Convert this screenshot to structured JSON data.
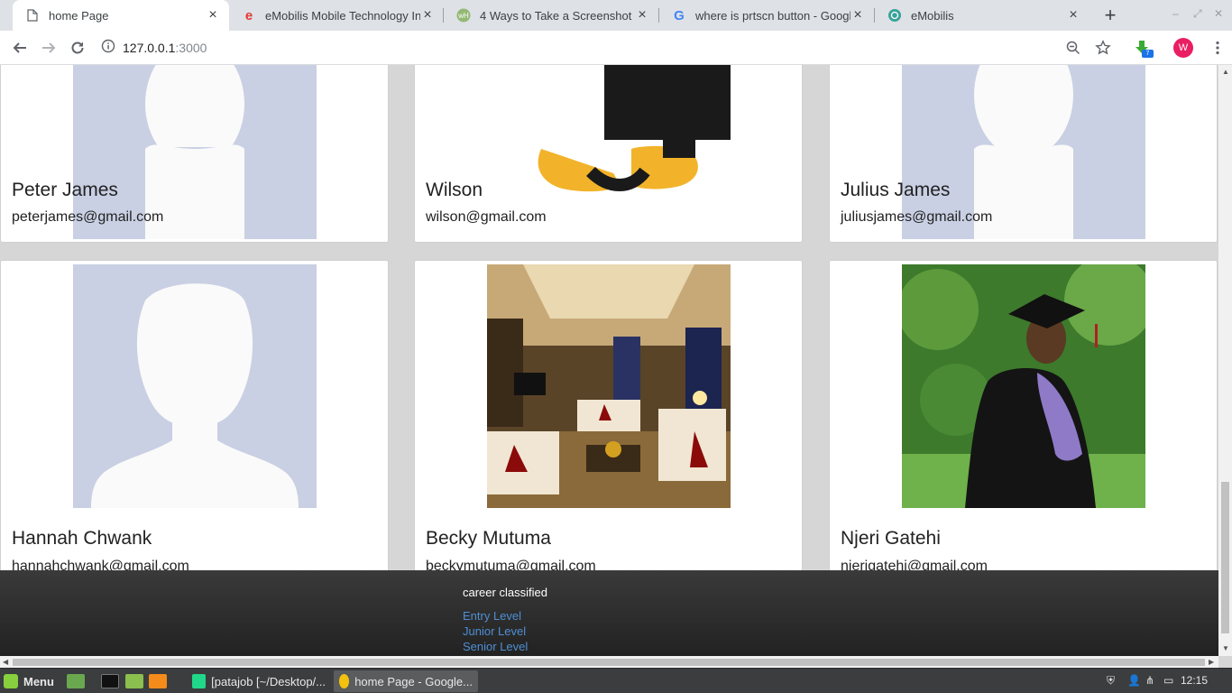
{
  "browser": {
    "tabs": [
      {
        "title": "home Page",
        "icon": "document-icon",
        "active": true
      },
      {
        "title": "eMobilis Mobile Technology Ins",
        "icon": "emobilis-e-icon",
        "active": false
      },
      {
        "title": "4 Ways to Take a Screenshot in",
        "icon": "wikihow-icon",
        "active": false
      },
      {
        "title": "where is prtscn button - Google",
        "icon": "google-g-icon",
        "active": false
      },
      {
        "title": "eMobilis",
        "icon": "globe-icon",
        "active": false
      }
    ],
    "address": {
      "host": "127.0.0.1",
      "port": ":3000"
    },
    "profile_initial": "W",
    "extension_badge": "7"
  },
  "cards_row1": [
    {
      "name": "Peter James",
      "email": "peterjames@gmail.com",
      "photo": "default-avatar"
    },
    {
      "name": "Wilson",
      "email": "wilson@gmail.com",
      "photo": "tux-penguin"
    },
    {
      "name": "Julius James",
      "email": "juliusjames@gmail.com",
      "photo": "default-avatar"
    }
  ],
  "cards_row2": [
    {
      "name": "Hannah Chwank",
      "email": "hannahchwank@gmail.com",
      "photo": "default-avatar"
    },
    {
      "name": "Becky Mutuma",
      "email": "beckymutuma@gmail.com",
      "photo": "living-room"
    },
    {
      "name": "Njeri Gatehi",
      "email": "njerigatehi@gmail.com",
      "photo": "graduation-portrait"
    }
  ],
  "footer": {
    "title": "career classified",
    "links": [
      "Entry Level",
      "Junior Level",
      "Senior Level"
    ]
  },
  "taskbar": {
    "menu_label": "Menu",
    "windows": [
      {
        "label": "[patajob [~/Desktop/...",
        "selected": false
      },
      {
        "label": "home Page - Google...",
        "selected": true
      }
    ],
    "clock": "12:15"
  }
}
